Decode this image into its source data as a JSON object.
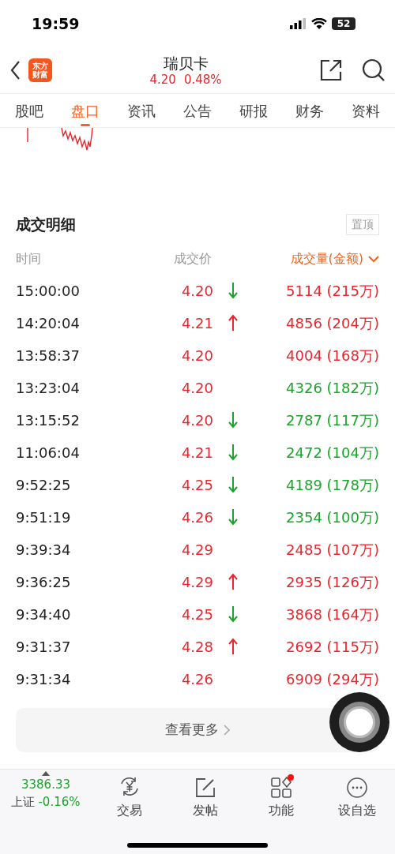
{
  "status_bar": {
    "time": "19:59",
    "battery": "52"
  },
  "header": {
    "logo": [
      "东方",
      "财富"
    ],
    "title": "瑞贝卡",
    "price": "4.20",
    "change": "0.48%"
  },
  "tabs": [
    {
      "label": "股吧",
      "selected": false
    },
    {
      "label": "盘口",
      "selected": true
    },
    {
      "label": "资讯",
      "selected": false
    },
    {
      "label": "公告",
      "selected": false
    },
    {
      "label": "研报",
      "selected": false
    },
    {
      "label": "财务",
      "selected": false
    },
    {
      "label": "资料",
      "selected": false
    }
  ],
  "section": {
    "title": "成交明细",
    "pin_button": "置顶"
  },
  "columns": [
    "时间",
    "成交价",
    "成交量(金额)"
  ],
  "trades": [
    {
      "time": "15:00:00",
      "price": "4.20",
      "kind": "down",
      "volume": "5114 (215万)",
      "color": "#e8262b"
    },
    {
      "time": "14:20:04",
      "price": "4.21",
      "kind": "up",
      "volume": "4856 (204万)",
      "color": "#e8262b"
    },
    {
      "time": "13:58:37",
      "price": "4.20",
      "kind": "plain",
      "volume": "4004 (168万)",
      "color": "#e8262b"
    },
    {
      "time": "13:23:04",
      "price": "4.20",
      "kind": "plain",
      "volume": "4326 (182万)",
      "color": "#1aa52a"
    },
    {
      "time": "13:15:52",
      "price": "4.20",
      "kind": "down",
      "volume": "2787 (117万)",
      "color": "#1aa52a"
    },
    {
      "time": "11:06:04",
      "price": "4.21",
      "kind": "down",
      "volume": "2472 (104万)",
      "color": "#1aa52a"
    },
    {
      "time": "9:52:25",
      "price": "4.25",
      "kind": "down",
      "volume": "4189 (178万)",
      "color": "#1aa52a"
    },
    {
      "time": "9:51:19",
      "price": "4.26",
      "kind": "down",
      "volume": "2354 (100万)",
      "color": "#1aa52a"
    },
    {
      "time": "9:39:34",
      "price": "4.29",
      "kind": "plain",
      "volume": "2485 (107万)",
      "color": "#e8262b"
    },
    {
      "time": "9:36:25",
      "price": "4.29",
      "kind": "up",
      "volume": "2935 (126万)",
      "color": "#e8262b"
    },
    {
      "time": "9:34:40",
      "price": "4.25",
      "kind": "down",
      "volume": "3868 (164万)",
      "color": "#e8262b"
    },
    {
      "time": "9:31:37",
      "price": "4.28",
      "kind": "up",
      "volume": "2692 (115万)",
      "color": "#e8262b"
    },
    {
      "time": "9:31:34",
      "price": "4.26",
      "kind": "plain",
      "volume": "6909 (294万)",
      "color": "#e8262b"
    }
  ],
  "more_button": "查看更多",
  "bottom_bar": {
    "index": {
      "value": "3386.33",
      "name": "上证",
      "change": "-0.16%"
    },
    "items": [
      {
        "kind": "trade",
        "label": "交易",
        "badge": false
      },
      {
        "kind": "post",
        "label": "发帖",
        "badge": false
      },
      {
        "kind": "apps",
        "label": "功能",
        "badge": true
      },
      {
        "kind": "more",
        "label": "设自选",
        "badge": false
      }
    ]
  }
}
